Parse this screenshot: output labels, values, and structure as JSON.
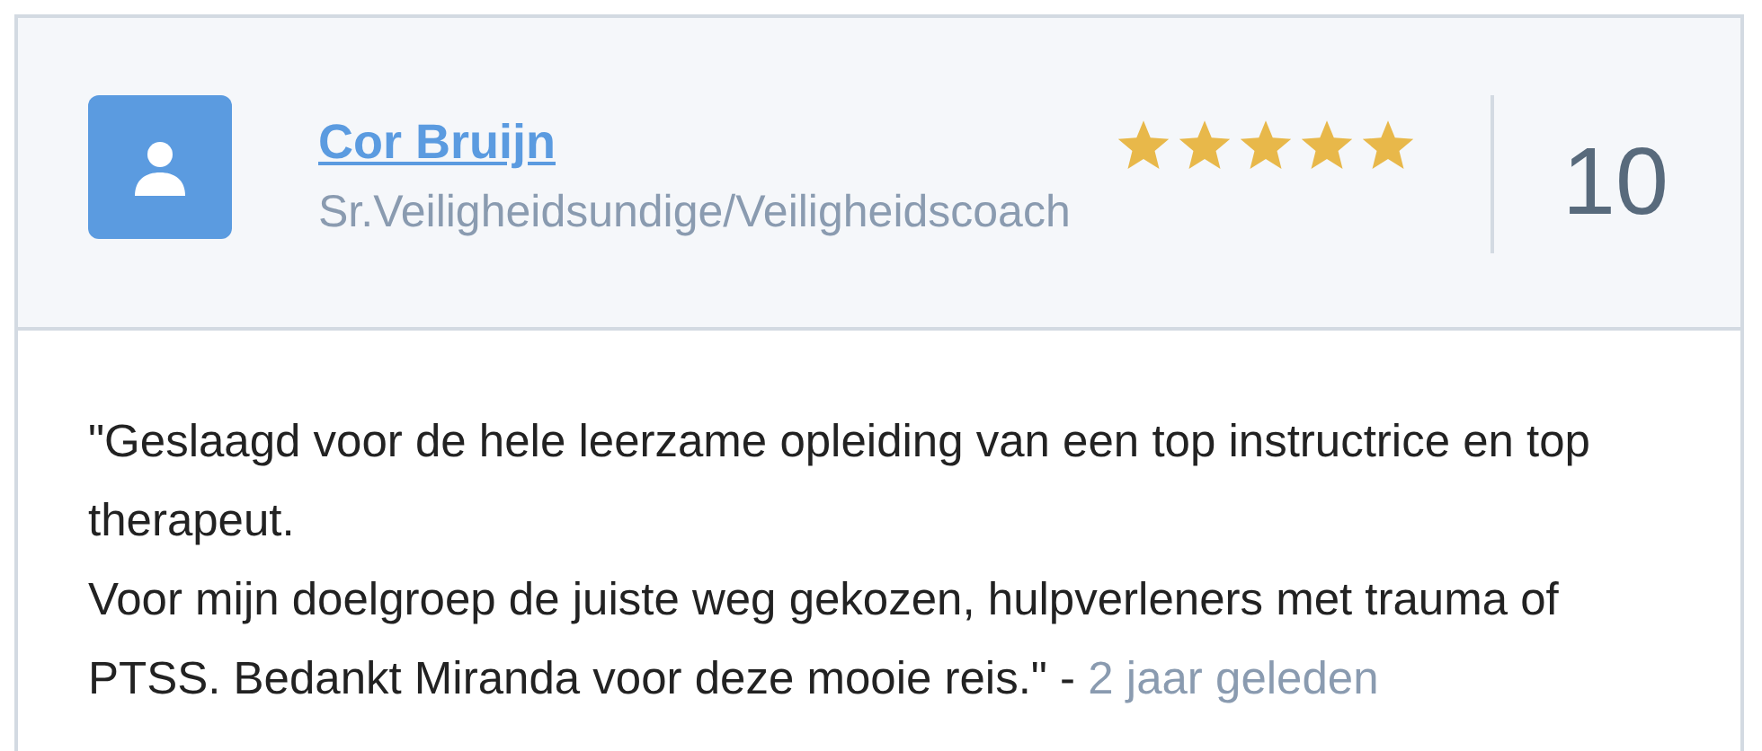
{
  "reviewer": {
    "name": "Cor Bruijn",
    "title": "Sr.Veiligheidsundige/Veiligheidscoach"
  },
  "rating": {
    "stars": 5,
    "score": "10"
  },
  "review": {
    "text": "\"Geslaagd voor de hele leerzame opleiding van een top instructrice en top therapeut.\nVoor mijn doelgroep de juiste weg gekozen, hulpverleners met trauma of PTSS. Bedankt Miranda voor deze mooie reis.\" -",
    "time": "2 jaar geleden"
  }
}
